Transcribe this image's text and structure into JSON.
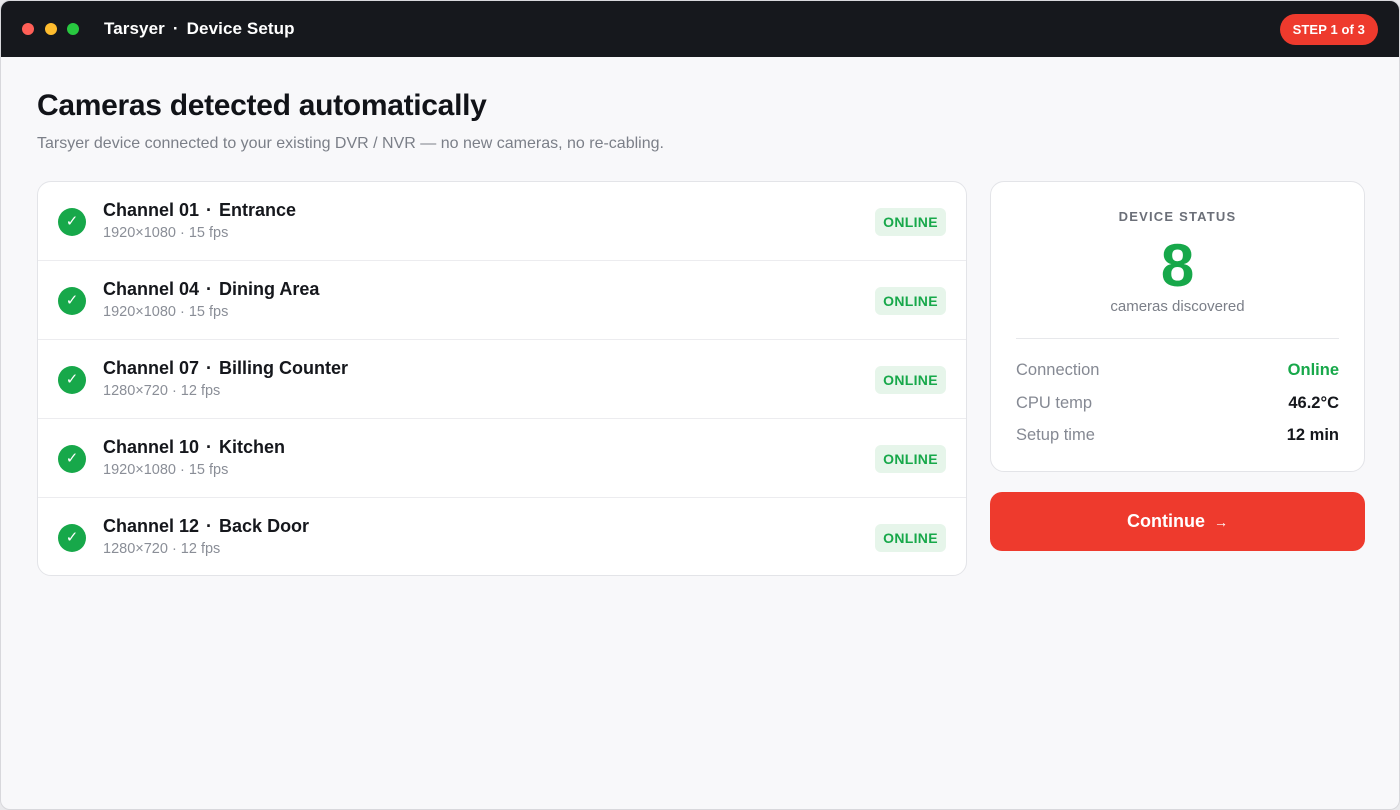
{
  "window": {
    "app_name": "Tarsyer",
    "separator": "·",
    "screen_title": "Device Setup",
    "step_badge": "STEP 1 of 3"
  },
  "main": {
    "heading": "Cameras detected automatically",
    "subheading": "Tarsyer device connected to your existing DVR / NVR — no new cameras, no re-cabling."
  },
  "cameras": [
    {
      "channel": "Channel 01",
      "location": "Entrance",
      "specs": "1920×1080 · 15 fps",
      "status": "ONLINE"
    },
    {
      "channel": "Channel 04",
      "location": "Dining Area",
      "specs": "1920×1080 · 15 fps",
      "status": "ONLINE"
    },
    {
      "channel": "Channel 07",
      "location": "Billing Counter",
      "specs": "1280×720 · 12 fps",
      "status": "ONLINE"
    },
    {
      "channel": "Channel 10",
      "location": "Kitchen",
      "specs": "1920×1080 · 15 fps",
      "status": "ONLINE"
    },
    {
      "channel": "Channel 12",
      "location": "Back Door",
      "specs": "1280×720 · 12 fps",
      "status": "ONLINE"
    }
  ],
  "status_card": {
    "title": "DEVICE STATUS",
    "count": "8",
    "caption": "cameras discovered",
    "rows": [
      {
        "label": "Connection",
        "value": "Online"
      },
      {
        "label": "CPU temp",
        "value": "46.2°C"
      },
      {
        "label": "Setup time",
        "value": "12 min"
      }
    ]
  },
  "actions": {
    "continue_label": "Continue",
    "continue_arrow": "→"
  },
  "colors": {
    "accent": "#ee3a2d",
    "success": "#17a84a",
    "titlebar": "#16181d"
  },
  "icons": {
    "camera_status": "check-circle-icon"
  }
}
